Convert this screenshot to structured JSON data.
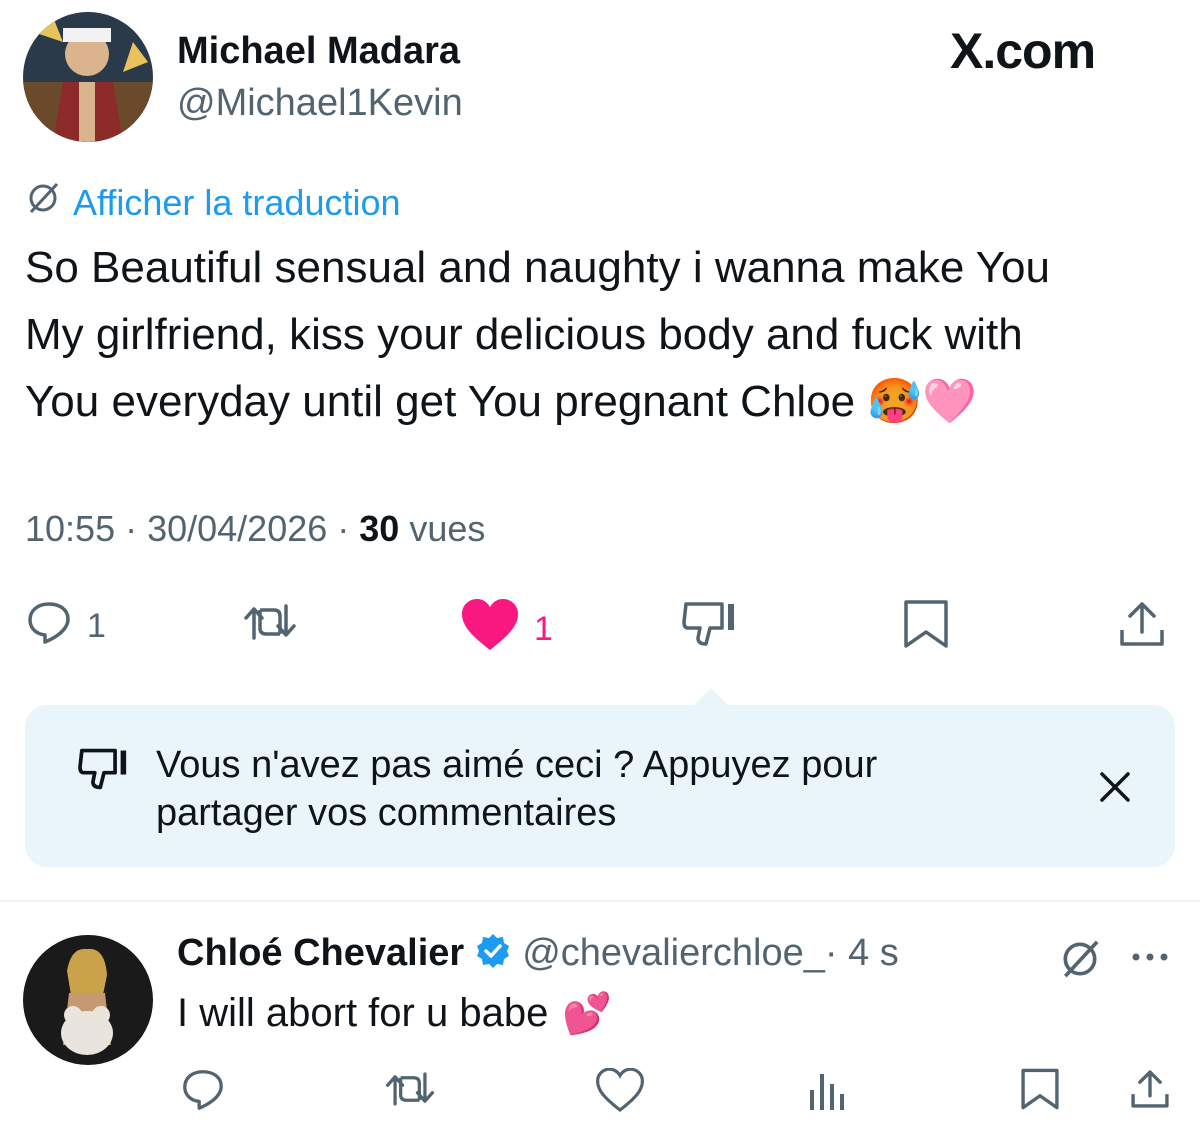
{
  "brand": "X.com",
  "tweet": {
    "author_name": "Michael Madara",
    "author_handle": "@Michael1Kevin",
    "translate_label": "Afficher la traduction",
    "text_line1": "So Beautiful sensual and naughty i wanna make You",
    "text_line2": "My girlfriend, kiss your delicious body and fuck with",
    "text_line3": "You everyday until get You pregnant Chloe",
    "emoji_hot": "🥵",
    "emoji_heart": "🩷",
    "time": "10:55",
    "sep1": " · ",
    "date": "30/04/2026",
    "sep2": " · ",
    "views_count": "30",
    "views_label": " vues",
    "reply_count": "1",
    "like_count": "1"
  },
  "banner": {
    "text": "Vous n'avez pas aimé ceci ? Appuyez pour partager vos commentaires"
  },
  "reply": {
    "author_name": "Chloé Chevalier",
    "author_handle": "@chevalierchloe_",
    "time": " · 4 s",
    "text": "I will abort for u babe",
    "emoji": "💕"
  },
  "colors": {
    "accent": "#1d9bf0",
    "like": "#f91880",
    "muted": "#536471",
    "banner_bg": "#eaf5fb",
    "verified": "#1d9bf0"
  },
  "icons": [
    "translate-icon",
    "reply-icon",
    "retweet-icon",
    "like-icon",
    "dislike-icon",
    "bookmark-icon",
    "share-icon",
    "close-icon",
    "verified-badge-icon",
    "more-icon",
    "views-icon"
  ]
}
